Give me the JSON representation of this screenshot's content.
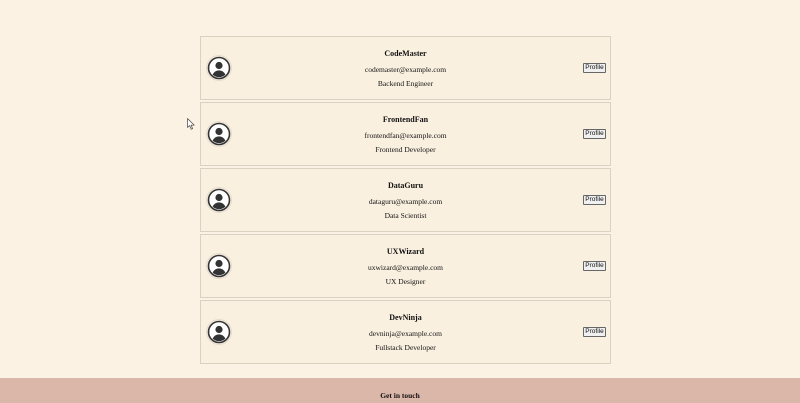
{
  "users": [
    {
      "name": "CodeMaster",
      "email": "codemaster@example.com",
      "role": "Backend Engineer",
      "button_label": "Profile",
      "avatar_icon": "user-circle-icon"
    },
    {
      "name": "FrontendFan",
      "email": "frontendfan@example.com",
      "role": "Frontend Developer",
      "button_label": "Profile",
      "avatar_icon": "user-circle-icon"
    },
    {
      "name": "DataGuru",
      "email": "dataguru@example.com",
      "role": "Data Scientist",
      "button_label": "Profile",
      "avatar_icon": "user-circle-icon"
    },
    {
      "name": "UXWizard",
      "email": "uxwizard@example.com",
      "role": "UX Designer",
      "button_label": "Profile",
      "avatar_icon": "user-circle-icon"
    },
    {
      "name": "DevNinja",
      "email": "devninja@example.com",
      "role": "Fullstack Developer",
      "button_label": "Profile",
      "avatar_icon": "user-circle-icon"
    }
  ],
  "footer": {
    "title": "Get in touch"
  },
  "colors": {
    "page_background": "#fcf2e3",
    "card_background": "#faf0e0",
    "footer_background": "#dbb7a9"
  }
}
